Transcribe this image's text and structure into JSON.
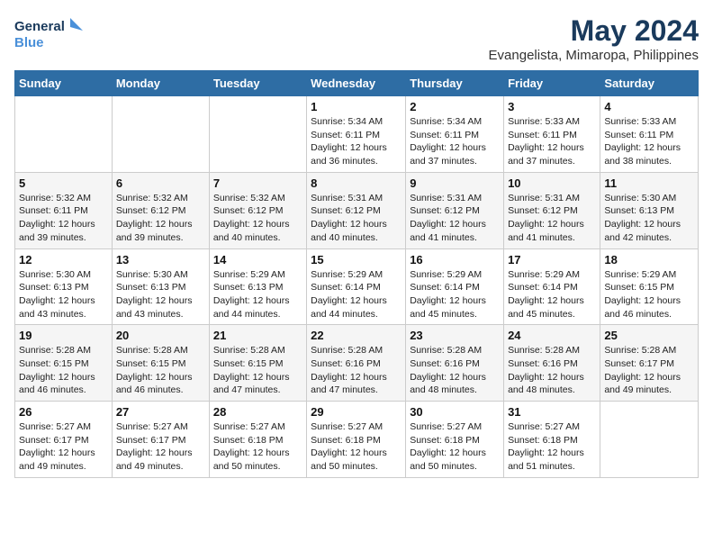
{
  "logo": {
    "line1": "General",
    "line2": "Blue"
  },
  "title": "May 2024",
  "subtitle": "Evangelista, Mimaropa, Philippines",
  "days_header": [
    "Sunday",
    "Monday",
    "Tuesday",
    "Wednesday",
    "Thursday",
    "Friday",
    "Saturday"
  ],
  "weeks": [
    [
      {
        "num": "",
        "detail": ""
      },
      {
        "num": "",
        "detail": ""
      },
      {
        "num": "",
        "detail": ""
      },
      {
        "num": "1",
        "detail": "Sunrise: 5:34 AM\nSunset: 6:11 PM\nDaylight: 12 hours\nand 36 minutes."
      },
      {
        "num": "2",
        "detail": "Sunrise: 5:34 AM\nSunset: 6:11 PM\nDaylight: 12 hours\nand 37 minutes."
      },
      {
        "num": "3",
        "detail": "Sunrise: 5:33 AM\nSunset: 6:11 PM\nDaylight: 12 hours\nand 37 minutes."
      },
      {
        "num": "4",
        "detail": "Sunrise: 5:33 AM\nSunset: 6:11 PM\nDaylight: 12 hours\nand 38 minutes."
      }
    ],
    [
      {
        "num": "5",
        "detail": "Sunrise: 5:32 AM\nSunset: 6:11 PM\nDaylight: 12 hours\nand 39 minutes."
      },
      {
        "num": "6",
        "detail": "Sunrise: 5:32 AM\nSunset: 6:12 PM\nDaylight: 12 hours\nand 39 minutes."
      },
      {
        "num": "7",
        "detail": "Sunrise: 5:32 AM\nSunset: 6:12 PM\nDaylight: 12 hours\nand 40 minutes."
      },
      {
        "num": "8",
        "detail": "Sunrise: 5:31 AM\nSunset: 6:12 PM\nDaylight: 12 hours\nand 40 minutes."
      },
      {
        "num": "9",
        "detail": "Sunrise: 5:31 AM\nSunset: 6:12 PM\nDaylight: 12 hours\nand 41 minutes."
      },
      {
        "num": "10",
        "detail": "Sunrise: 5:31 AM\nSunset: 6:12 PM\nDaylight: 12 hours\nand 41 minutes."
      },
      {
        "num": "11",
        "detail": "Sunrise: 5:30 AM\nSunset: 6:13 PM\nDaylight: 12 hours\nand 42 minutes."
      }
    ],
    [
      {
        "num": "12",
        "detail": "Sunrise: 5:30 AM\nSunset: 6:13 PM\nDaylight: 12 hours\nand 43 minutes."
      },
      {
        "num": "13",
        "detail": "Sunrise: 5:30 AM\nSunset: 6:13 PM\nDaylight: 12 hours\nand 43 minutes."
      },
      {
        "num": "14",
        "detail": "Sunrise: 5:29 AM\nSunset: 6:13 PM\nDaylight: 12 hours\nand 44 minutes."
      },
      {
        "num": "15",
        "detail": "Sunrise: 5:29 AM\nSunset: 6:14 PM\nDaylight: 12 hours\nand 44 minutes."
      },
      {
        "num": "16",
        "detail": "Sunrise: 5:29 AM\nSunset: 6:14 PM\nDaylight: 12 hours\nand 45 minutes."
      },
      {
        "num": "17",
        "detail": "Sunrise: 5:29 AM\nSunset: 6:14 PM\nDaylight: 12 hours\nand 45 minutes."
      },
      {
        "num": "18",
        "detail": "Sunrise: 5:29 AM\nSunset: 6:15 PM\nDaylight: 12 hours\nand 46 minutes."
      }
    ],
    [
      {
        "num": "19",
        "detail": "Sunrise: 5:28 AM\nSunset: 6:15 PM\nDaylight: 12 hours\nand 46 minutes."
      },
      {
        "num": "20",
        "detail": "Sunrise: 5:28 AM\nSunset: 6:15 PM\nDaylight: 12 hours\nand 46 minutes."
      },
      {
        "num": "21",
        "detail": "Sunrise: 5:28 AM\nSunset: 6:15 PM\nDaylight: 12 hours\nand 47 minutes."
      },
      {
        "num": "22",
        "detail": "Sunrise: 5:28 AM\nSunset: 6:16 PM\nDaylight: 12 hours\nand 47 minutes."
      },
      {
        "num": "23",
        "detail": "Sunrise: 5:28 AM\nSunset: 6:16 PM\nDaylight: 12 hours\nand 48 minutes."
      },
      {
        "num": "24",
        "detail": "Sunrise: 5:28 AM\nSunset: 6:16 PM\nDaylight: 12 hours\nand 48 minutes."
      },
      {
        "num": "25",
        "detail": "Sunrise: 5:28 AM\nSunset: 6:17 PM\nDaylight: 12 hours\nand 49 minutes."
      }
    ],
    [
      {
        "num": "26",
        "detail": "Sunrise: 5:27 AM\nSunset: 6:17 PM\nDaylight: 12 hours\nand 49 minutes."
      },
      {
        "num": "27",
        "detail": "Sunrise: 5:27 AM\nSunset: 6:17 PM\nDaylight: 12 hours\nand 49 minutes."
      },
      {
        "num": "28",
        "detail": "Sunrise: 5:27 AM\nSunset: 6:18 PM\nDaylight: 12 hours\nand 50 minutes."
      },
      {
        "num": "29",
        "detail": "Sunrise: 5:27 AM\nSunset: 6:18 PM\nDaylight: 12 hours\nand 50 minutes."
      },
      {
        "num": "30",
        "detail": "Sunrise: 5:27 AM\nSunset: 6:18 PM\nDaylight: 12 hours\nand 50 minutes."
      },
      {
        "num": "31",
        "detail": "Sunrise: 5:27 AM\nSunset: 6:18 PM\nDaylight: 12 hours\nand 51 minutes."
      },
      {
        "num": "",
        "detail": ""
      }
    ]
  ]
}
